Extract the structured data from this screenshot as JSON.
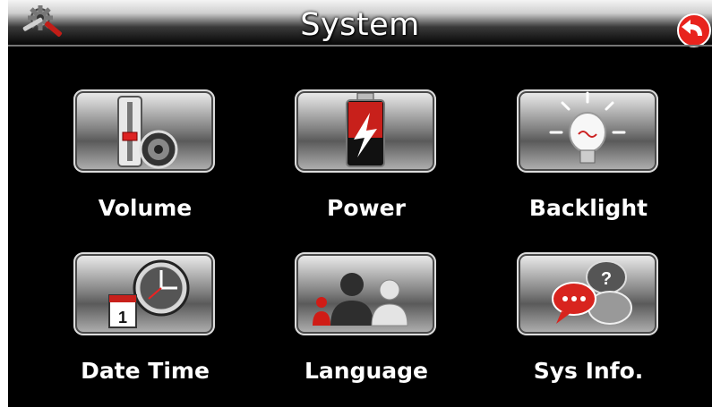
{
  "header": {
    "title": "System"
  },
  "menu": {
    "volume": "Volume",
    "power": "Power",
    "backlight": "Backlight",
    "datetime": "Date Time",
    "language": "Language",
    "sysinfo": "Sys Info."
  },
  "icons": {
    "settings": "settings-gear-icon",
    "back": "back-arrow-icon",
    "volume": "volume-slider-speaker-icon",
    "power": "battery-icon",
    "backlight": "light-bulb-icon",
    "datetime": "calendar-clock-icon",
    "language": "people-icon",
    "sysinfo": "chat-bubbles-icon"
  },
  "datetime_icon": {
    "calendar_day": "1"
  },
  "colors": {
    "background": "#000000",
    "accent_red": "#e8231d",
    "label": "#ffffff"
  }
}
